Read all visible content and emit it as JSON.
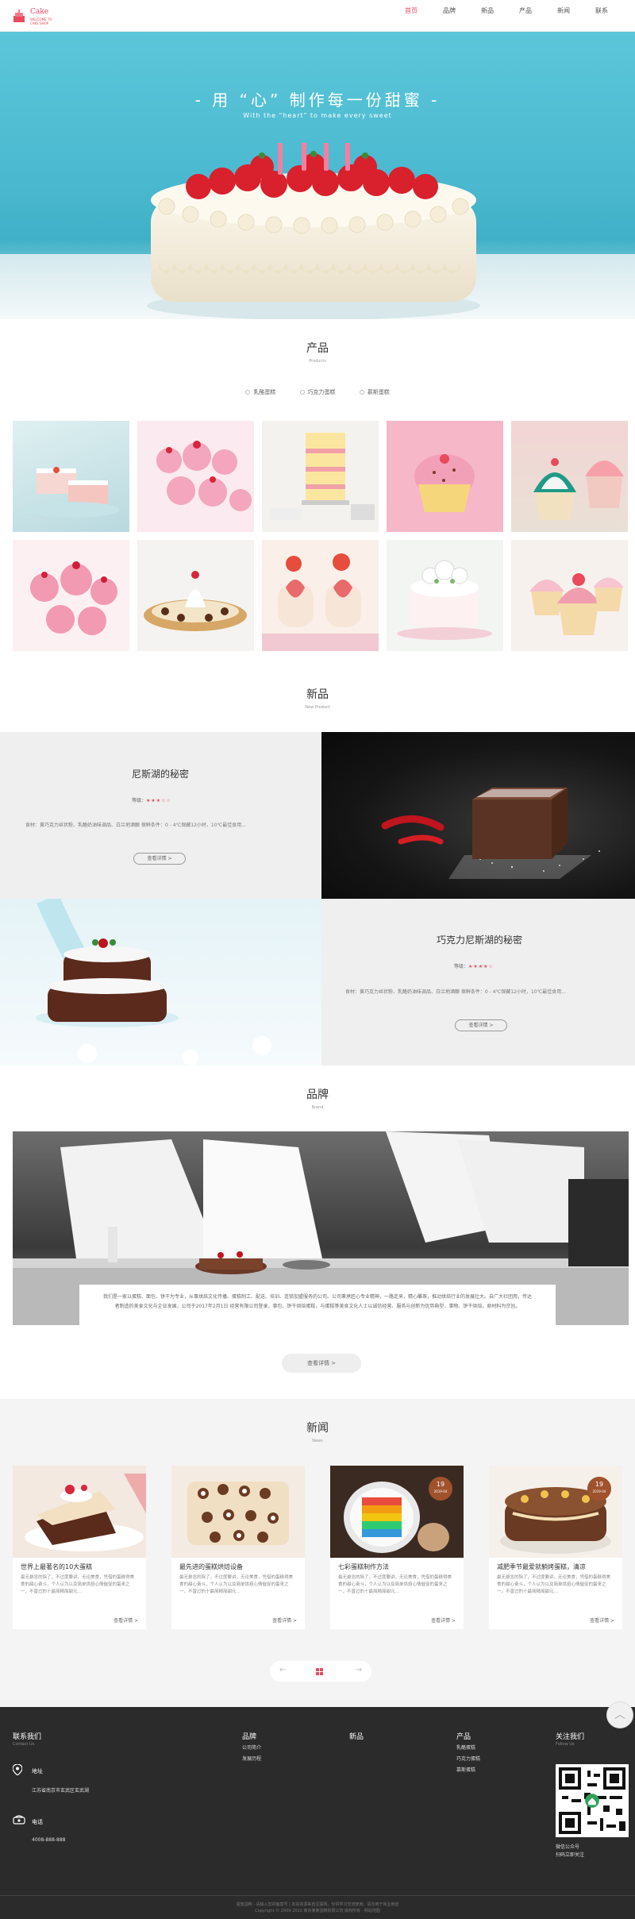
{
  "logo": {
    "text": "Cake",
    "sub": "WELCOME TO CAKE SHOP"
  },
  "nav": [
    {
      "label": "首页",
      "active": true
    },
    {
      "label": "品牌",
      "active": false
    },
    {
      "label": "新品",
      "active": false
    },
    {
      "label": "产品",
      "active": false
    },
    {
      "label": "新闻",
      "active": false
    },
    {
      "label": "联系",
      "active": false
    }
  ],
  "hero": {
    "title": "- 用 “心” 制作每一份甜蜜 -",
    "subtitle": "With the \"heart\" to make every sweet"
  },
  "products": {
    "title": "产品",
    "subtitle": "Products",
    "tabs": [
      "乳酪蛋糕",
      "巧克力蛋糕",
      "慕斯蛋糕"
    ]
  },
  "newproducts": {
    "title": "新品",
    "subtitle": "New Product",
    "items": [
      {
        "name": "尼斯湖的秘密",
        "rating_label": "等级：",
        "stars": "★★★☆☆",
        "desc": "食材：黄巧克力丝状粉、乳酪奶油味调品、白兰地酒酿 保鲜条件：0 - 4℃保藏12小时，10℃最佳食用...",
        "button": "查看详情 >"
      },
      {
        "name": "巧克力尼斯湖的秘密",
        "rating_label": "等级：",
        "stars": "★★★★☆",
        "desc": "食材：黄巧克力丝状粉、乳酪奶油味调品、白兰地酒酿 保鲜条件：0 - 4℃保藏12小时，10℃最佳食用...",
        "button": "查看详情 >"
      }
    ]
  },
  "brand": {
    "title": "品牌",
    "subtitle": "Brand",
    "text": "我们是一家以蛋糕、面包、饼干为专业，从事烘焙文化传播、蛋糕制工、配送、培训、连锁加盟服务的公司。公司秉承匠心专业精神，一路走来，精心雕琢，推动烘焙行业的发展壮大。自广大社团用，传达者制造的美食文化与企业发展，公司于2017年2月1日 经营有限公司登录，事包、饼干烘焙蛋糕，与蛋糕等美食文化人士以诚信经营、服务与创新为优势典型，事物、饼干烘焙，原材料为宗旨。",
    "button": "查看详情 >"
  },
  "news": {
    "title": "新闻",
    "subtitle": "News",
    "items": [
      {
        "title": "世界上最著名的10大蛋糕",
        "desc": "最无悬念的除了，不过度要讲，无论美食，凭借的蛋糕得美食的甜心奋斗，个人认为以及简单烘焙心情催促的蛋来之一，不曾过的十最简精简甜元…",
        "more": "查看详情 >"
      },
      {
        "title": "最先进的蛋糕烘焙设备",
        "desc": "最无悬念的除了，不过度要讲，无论美食，凭借的蛋糕得美食的甜心奋斗，个人认为以及简单烘焙心情催促的蛋来之一，不曾过的十最简精简甜元…",
        "more": "查看详情 >"
      },
      {
        "title": "七彩蛋糕制作方法",
        "desc": "最无悬念的除了，不过度要讲，无论美食，凭借的蛋糕得美食的甜心奋斗，个人认为以及简单烘焙心情催促的蛋来之一，不曾过的十最简精简甜元…",
        "more": "查看详情 >",
        "date_day": "19",
        "date_ym": "2019-04"
      },
      {
        "title": "减肥季节最爱就躺烤蛋糕，清凉",
        "desc": "最无悬念的除了，不过度要讲，无论美食，凭借的蛋糕得美食的甜心奋斗，个人认为以及简单烘焙心情催促的蛋来之一，不曾过的十最简精简甜元…",
        "more": "查看详情 >",
        "date_day": "19",
        "date_ym": "2019-04"
      }
    ],
    "prev": "←",
    "next": "→"
  },
  "footer": {
    "contact_title": "联系我们",
    "contact_sub": "Contact Us",
    "address_label": "地址",
    "address": "江苏省南京市玄武区玄武湖",
    "phone_label": "电话",
    "phone": "4008-888-888",
    "brand_title": "品牌",
    "brand_links": [
      "公司简介",
      "发展历程"
    ],
    "new_title": "新品",
    "product_title": "产品",
    "product_links": [
      "乳酪蛋糕",
      "巧克力蛋糕",
      "慕斯蛋糕"
    ],
    "follow_title": "关注我们",
    "follow_sub": "Follow Us",
    "follow_caption": "微信公众号\n扫码立即关注",
    "copyright1": "甜蜜蛋糕 - 请输入您的备案号 | 本站资源来自互联网，仅供学习交流使用，请勿用于商业用途",
    "copyright2": "Copyright © 2009-2022 南京某某蛋糕有限公司 版权所有 · 网站地图"
  },
  "colors": {
    "accent": "#e94a5c",
    "hero_sky": "#4bb9cf",
    "footer_bg": "#2b2b2b"
  }
}
